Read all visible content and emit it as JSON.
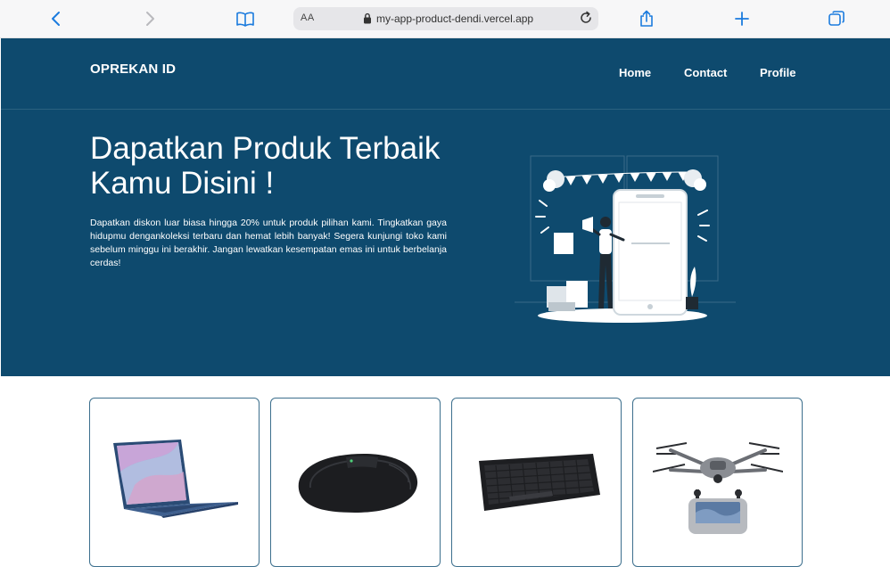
{
  "browser": {
    "address": {
      "text_size": "AA",
      "url": "my-app-product-dendi.vercel.app"
    }
  },
  "site": {
    "brand": "OPREKAN ID",
    "nav": [
      {
        "label": "Home"
      },
      {
        "label": "Contact"
      },
      {
        "label": "Profile"
      }
    ]
  },
  "hero": {
    "title": "Dapatkan Produk Terbaik Kamu Disini !",
    "text": "Dapatkan diskon luar biasa hingga 20% untuk produk pilihan kami. Tingkatkan gaya hidupmu dengankoleksi terbaru dan hemat lebih banyak! Segera kunjungi toko kami sebelum minggu ini berakhir. Jangan lewatkan kesempatan emas ini untuk berbelanja cerdas!"
  },
  "products": [
    {
      "icon": "laptop-icon"
    },
    {
      "icon": "mouse-icon"
    },
    {
      "icon": "keyboard-icon"
    },
    {
      "icon": "drone-icon"
    }
  ],
  "colors": {
    "primary": "#0e4a6e",
    "chrome_icon": "#1b7bde",
    "card_border": "#3c6f8d"
  }
}
